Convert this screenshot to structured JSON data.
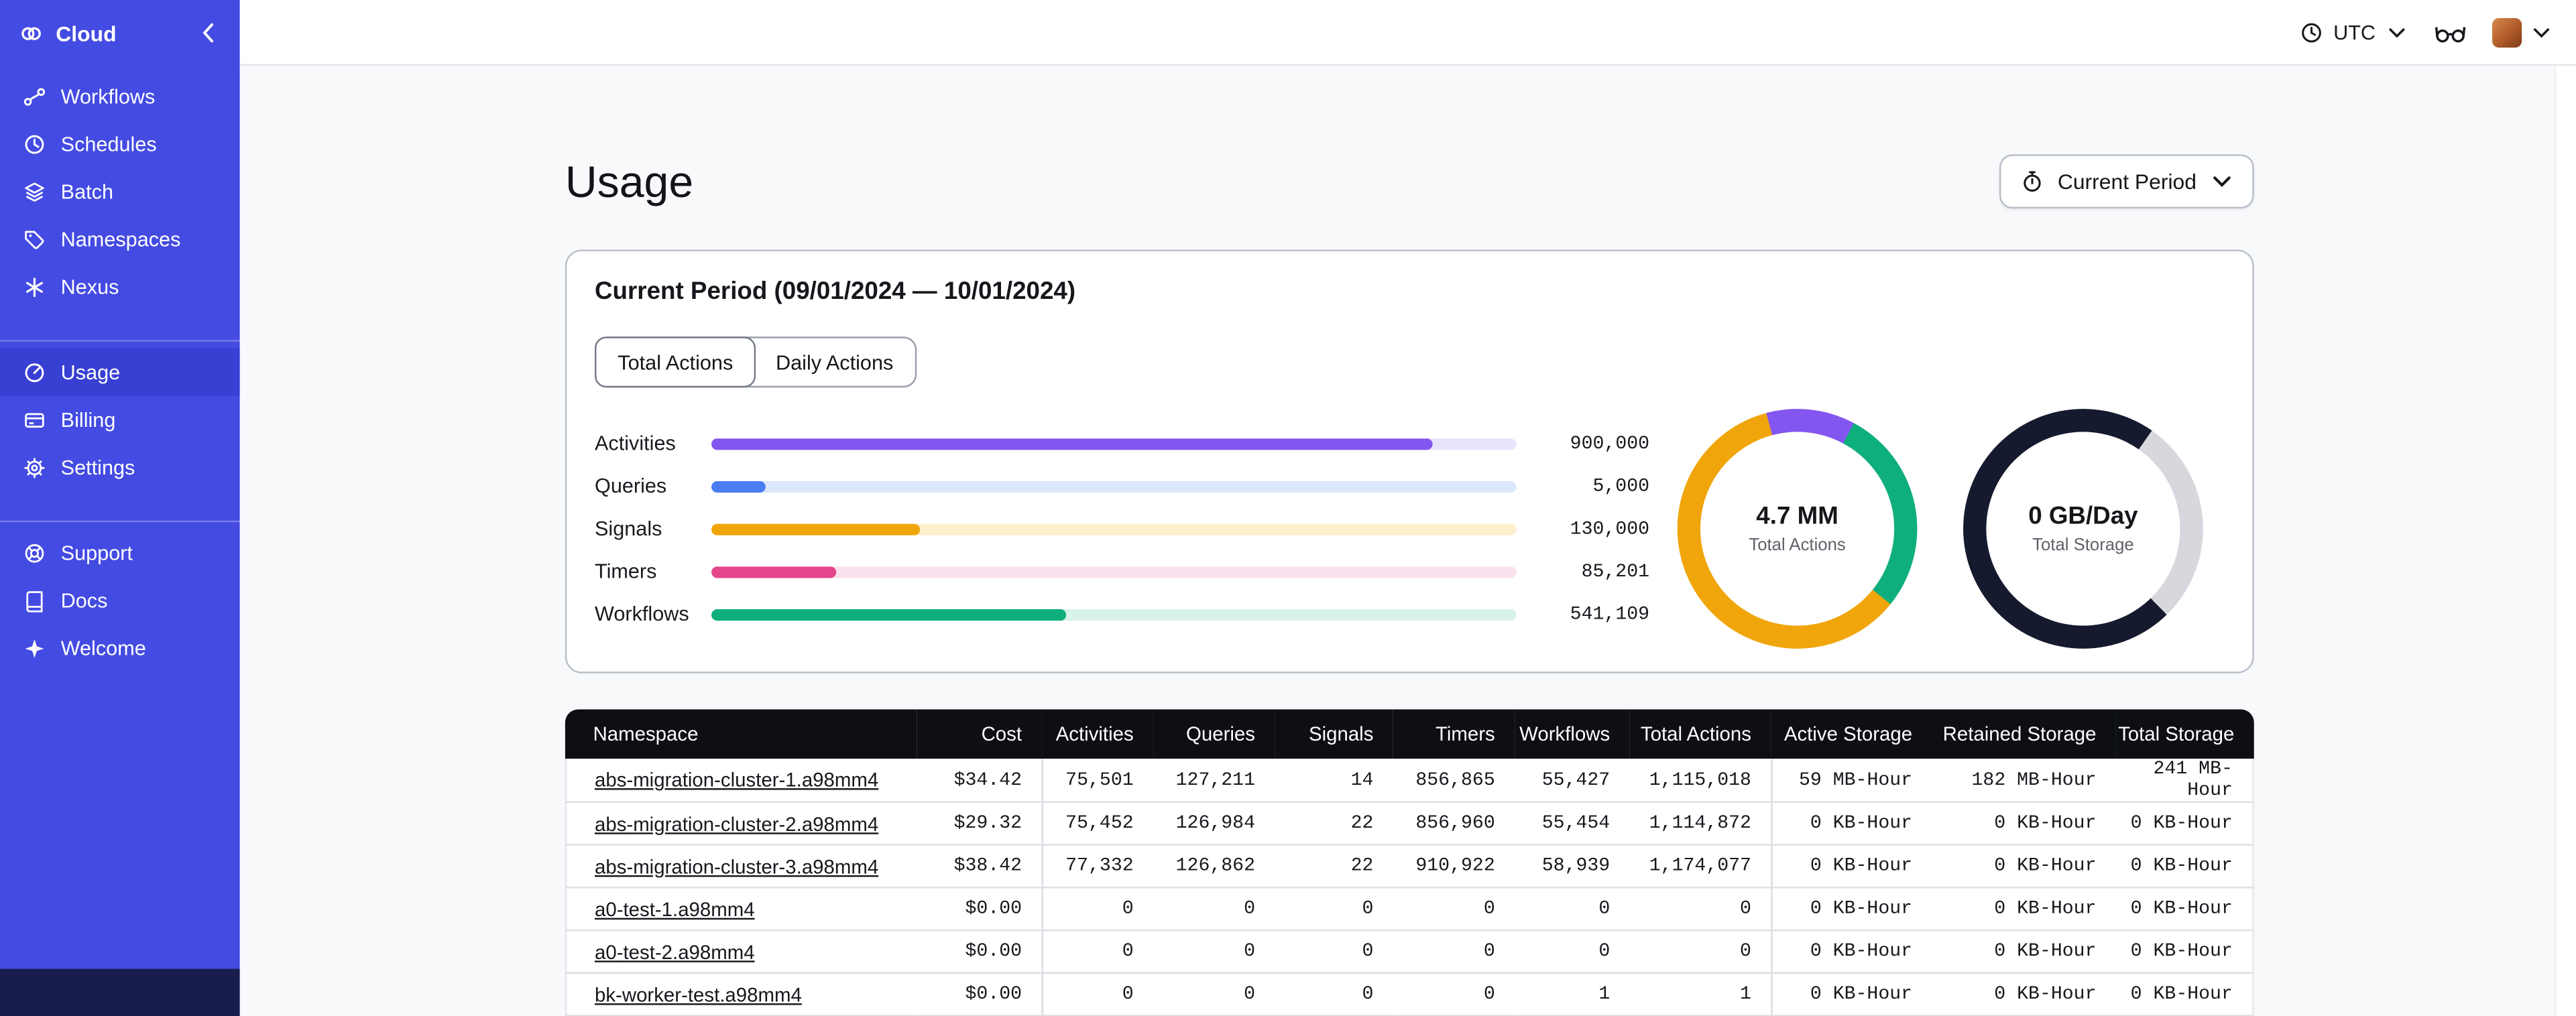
{
  "sidebar": {
    "logo_label": "Cloud",
    "nav_primary": [
      {
        "label": "Workflows"
      },
      {
        "label": "Schedules"
      },
      {
        "label": "Batch"
      },
      {
        "label": "Namespaces"
      },
      {
        "label": "Nexus"
      }
    ],
    "nav_account": [
      {
        "label": "Usage",
        "active": true
      },
      {
        "label": "Billing",
        "active": false
      },
      {
        "label": "Settings",
        "active": false
      }
    ],
    "nav_help": [
      {
        "label": "Support"
      },
      {
        "label": "Docs"
      },
      {
        "label": "Welcome"
      }
    ]
  },
  "topbar": {
    "timezone": "UTC"
  },
  "page": {
    "title": "Usage",
    "period_selector_label": "Current Period"
  },
  "card": {
    "title": "Current Period (09/01/2024 — 10/01/2024)",
    "tabs": [
      {
        "label": "Total Actions",
        "active": true
      },
      {
        "label": "Daily Actions",
        "active": false
      }
    ]
  },
  "chart_data": [
    {
      "type": "bar",
      "orientation": "horizontal",
      "categories": [
        "Activities",
        "Queries",
        "Signals",
        "Timers",
        "Workflows"
      ],
      "values": [
        900000,
        5000,
        130000,
        85201,
        541109
      ],
      "value_labels": [
        "900,000",
        "5,000",
        "130,000",
        "85,201",
        "541,109"
      ],
      "colors": [
        "#8456f0",
        "#4a7df2",
        "#f0a50a",
        "#e5458a",
        "#0faf7d"
      ],
      "track_colors": [
        "#e9e4fd",
        "#dbe7fd",
        "#fdf0cd",
        "#fbe0ee",
        "#d8f3e7"
      ],
      "fill_percents": [
        89.5,
        6.8,
        26,
        15.5,
        44
      ],
      "title": "",
      "xlabel": "",
      "ylabel": ""
    },
    {
      "type": "pie",
      "title": "Total Actions",
      "center_value": "4.7 MM",
      "rotation_deg": -15,
      "slices": [
        {
          "color": "#8456f0",
          "percent": 12
        },
        {
          "color": "#0faf7d",
          "percent": 28
        },
        {
          "color": "#f0a50a",
          "percent": 60
        }
      ]
    },
    {
      "type": "pie",
      "title": "Total Storage",
      "center_value": "0 GB/Day",
      "rotation_deg": 35,
      "slices": [
        {
          "color": "#d6d8de",
          "percent": 28
        },
        {
          "color": "#161a2e",
          "percent": 72
        }
      ]
    }
  ],
  "table": {
    "columns": [
      "Namespace",
      "Cost",
      "Activities",
      "Queries",
      "Signals",
      "Timers",
      "Workflows",
      "Total Actions",
      "Active Storage",
      "Retained Storage",
      "Total Storage"
    ],
    "rows": [
      [
        "abs-migration-cluster-1.a98mm4",
        "$34.42",
        "75,501",
        "127,211",
        "14",
        "856,865",
        "55,427",
        "1,115,018",
        "59 MB-Hour",
        "182 MB-Hour",
        "241 MB-Hour"
      ],
      [
        "abs-migration-cluster-2.a98mm4",
        "$29.32",
        "75,452",
        "126,984",
        "22",
        "856,960",
        "55,454",
        "1,114,872",
        "0 KB-Hour",
        "0 KB-Hour",
        "0 KB-Hour"
      ],
      [
        "abs-migration-cluster-3.a98mm4",
        "$38.42",
        "77,332",
        "126,862",
        "22",
        "910,922",
        "58,939",
        "1,174,077",
        "0 KB-Hour",
        "0 KB-Hour",
        "0 KB-Hour"
      ],
      [
        "a0-test-1.a98mm4",
        "$0.00",
        "0",
        "0",
        "0",
        "0",
        "0",
        "0",
        "0 KB-Hour",
        "0 KB-Hour",
        "0 KB-Hour"
      ],
      [
        "a0-test-2.a98mm4",
        "$0.00",
        "0",
        "0",
        "0",
        "0",
        "0",
        "0",
        "0 KB-Hour",
        "0 KB-Hour",
        "0 KB-Hour"
      ],
      [
        "bk-worker-test.a98mm4",
        "$0.00",
        "0",
        "0",
        "0",
        "0",
        "1",
        "1",
        "0 KB-Hour",
        "0 KB-Hour",
        "0 KB-Hour"
      ]
    ]
  }
}
